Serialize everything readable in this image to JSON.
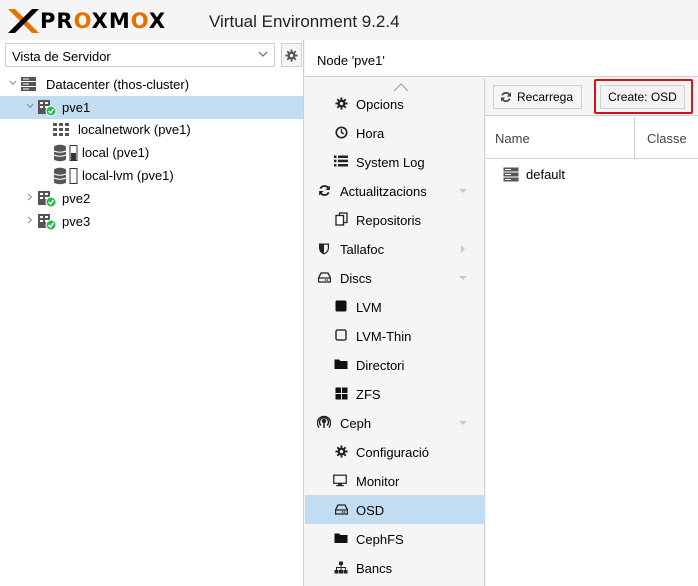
{
  "header": {
    "logo_text_prefix": "PR",
    "logo_text_o1": "O",
    "logo_text_mid": "XM",
    "logo_text_o2": "O",
    "logo_text_suffix": "X",
    "app_title": "Virtual Environment 9.2.4"
  },
  "left": {
    "view_select_value": "Vista de Servidor",
    "tree": [
      {
        "label": "Datacenter (thos-cluster)",
        "icon": "datacenter-icon"
      },
      {
        "label": "pve1",
        "icon": "node-online-icon",
        "selected": true
      },
      {
        "label": "localnetwork (pve1)",
        "icon": "network-grid-icon"
      },
      {
        "label": "local (pve1)",
        "icon": "storage-icon"
      },
      {
        "label": "local-lvm (pve1)",
        "icon": "storage-icon"
      },
      {
        "label": "pve2",
        "icon": "node-online-icon"
      },
      {
        "label": "pve3",
        "icon": "node-online-icon"
      }
    ]
  },
  "node_title": "Node 'pve1'",
  "nav": [
    {
      "label": "Opcions",
      "icon": "gear-icon"
    },
    {
      "label": "Hora",
      "icon": "clock-icon"
    },
    {
      "label": "System Log",
      "icon": "list-icon"
    },
    {
      "label": "Actualitzacions",
      "icon": "refresh-icon",
      "expander": "down"
    },
    {
      "label": "Repositoris",
      "icon": "copy-icon"
    },
    {
      "label": "Tallafoc",
      "icon": "shield-icon",
      "expander": "right"
    },
    {
      "label": "Discs",
      "icon": "hdd-icon",
      "expander": "down"
    },
    {
      "label": "LVM",
      "icon": "square-icon"
    },
    {
      "label": "LVM-Thin",
      "icon": "square-outline-icon"
    },
    {
      "label": "Directori",
      "icon": "folder-icon"
    },
    {
      "label": "ZFS",
      "icon": "th-large-icon"
    },
    {
      "label": "Ceph",
      "icon": "ceph-icon",
      "expander": "down"
    },
    {
      "label": "Configuració",
      "icon": "gear-icon"
    },
    {
      "label": "Monitor",
      "icon": "desktop-icon"
    },
    {
      "label": "OSD",
      "icon": "hdd-icon",
      "selected": true
    },
    {
      "label": "CephFS",
      "icon": "folder-icon"
    },
    {
      "label": "Bancs",
      "icon": "sitemap-icon"
    }
  ],
  "toolbar": {
    "reload_label": "Recarrega",
    "create_label": "Create: OSD"
  },
  "grid": {
    "columns": [
      "Name",
      "Classe"
    ],
    "rows": [
      {
        "name": "default",
        "icon": "server-icon"
      }
    ]
  },
  "colors": {
    "selected_bg": "#c2ddf2",
    "brand_orange": "#e57000",
    "highlight_red": "#d9101c",
    "online_green": "#21bf4b"
  }
}
